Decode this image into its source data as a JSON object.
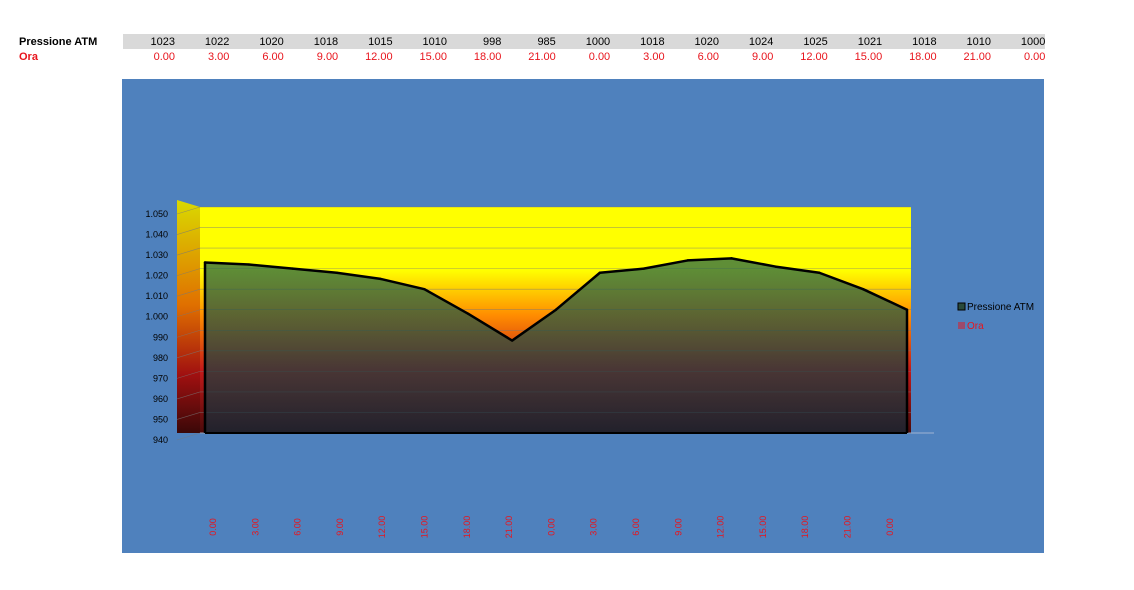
{
  "table": {
    "row1_label": "Pressione ATM",
    "row2_label": "Ora",
    "pressione": [
      "1023",
      "1022",
      "1020",
      "1018",
      "1015",
      "1010",
      "998",
      "985",
      "1000",
      "1018",
      "1020",
      "1024",
      "1025",
      "1021",
      "1018",
      "1010",
      "1000"
    ],
    "ora": [
      "0.00",
      "3.00",
      "6.00",
      "9.00",
      "12.00",
      "15.00",
      "18.00",
      "21.00",
      "0.00",
      "3.00",
      "6.00",
      "9.00",
      "12.00",
      "15.00",
      "18.00",
      "21.00",
      "0.00"
    ]
  },
  "colors": {
    "background": "#4f81bd",
    "wall_top": "#ffff00",
    "wall_mid": "#ff8c00",
    "area_fill": "#1f3a3a",
    "series_line": "#000000",
    "label_red": "#e8141c"
  },
  "chart_data": {
    "type": "area",
    "title": "",
    "categories": [
      "0.00",
      "3.00",
      "6.00",
      "9.00",
      "12.00",
      "15.00",
      "18.00",
      "21.00",
      "0.00",
      "3.00",
      "6.00",
      "9.00",
      "12.00",
      "15.00",
      "18.00",
      "21.00",
      "0.00"
    ],
    "series": [
      {
        "name": "Pressione ATM",
        "values": [
          1023,
          1022,
          1020,
          1018,
          1015,
          1010,
          998,
          985,
          1000,
          1018,
          1020,
          1024,
          1025,
          1021,
          1018,
          1010,
          1000
        ]
      },
      {
        "name": "Ora",
        "values": [
          0,
          3,
          6,
          9,
          12,
          15,
          18,
          21,
          0,
          3,
          6,
          9,
          12,
          15,
          18,
          21,
          0
        ]
      }
    ],
    "ylim": [
      940,
      1050
    ],
    "yticks": [
      "940",
      "950",
      "960",
      "970",
      "980",
      "990",
      "1.000",
      "1.010",
      "1.020",
      "1.030",
      "1.040",
      "1.050"
    ],
    "grid": true,
    "legend_position": "right"
  }
}
